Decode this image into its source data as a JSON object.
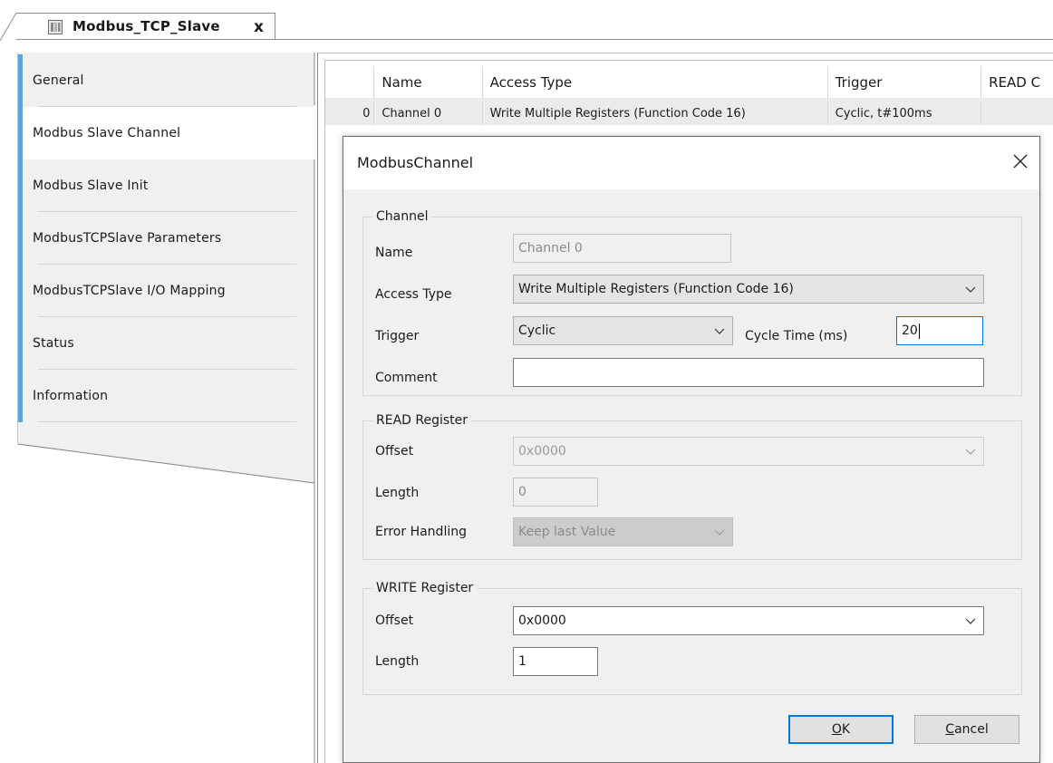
{
  "tab": {
    "title": "Modbus_TCP_Slave",
    "close_glyph": "x",
    "icon": "device-icon"
  },
  "nav": {
    "items": [
      {
        "label": "General"
      },
      {
        "label": "Modbus Slave Channel"
      },
      {
        "label": "Modbus Slave Init"
      },
      {
        "label": "ModbusTCPSlave Parameters"
      },
      {
        "label": "ModbusTCPSlave I/O Mapping"
      },
      {
        "label": "Status"
      },
      {
        "label": "Information"
      }
    ],
    "active_index": 1,
    "accent_color": "#5da3de"
  },
  "grid": {
    "columns": [
      "",
      "Name",
      "Access Type",
      "Trigger",
      "READ Offset"
    ],
    "columns_visible": [
      "",
      "Name",
      "Access Type",
      "Trigger",
      "READ C"
    ],
    "rows": [
      {
        "index": "0",
        "name": "Channel 0",
        "access": "Write Multiple Registers (Function Code 16)",
        "trigger": "Cyclic, t#100ms",
        "read": ""
      }
    ]
  },
  "dialog": {
    "title": "ModbusChannel",
    "close_icon": "close-icon",
    "channel": {
      "group_label": "Channel",
      "name_label": "Name",
      "name_value": "Channel 0",
      "access_label": "Access Type",
      "access_value": "Write Multiple Registers (Function Code 16)",
      "trigger_label": "Trigger",
      "trigger_value": "Cyclic",
      "cycle_label": "Cycle Time (ms)",
      "cycle_value": "20",
      "comment_label": "Comment",
      "comment_value": ""
    },
    "read": {
      "group_label": "READ Register",
      "offset_label": "Offset",
      "offset_value": "0x0000",
      "length_label": "Length",
      "length_value": "0",
      "error_label": "Error Handling",
      "error_value": "Keep last Value"
    },
    "write": {
      "group_label": "WRITE Register",
      "offset_label": "Offset",
      "offset_value": "0x0000",
      "length_label": "Length",
      "length_value": "1"
    },
    "ok_label": "OK",
    "ok_mnemonic": "O",
    "ok_rest": "K",
    "cancel_label": "Cancel",
    "cancel_mnemonic": "C",
    "cancel_rest": "ancel",
    "focus_color": "#0078d7"
  }
}
